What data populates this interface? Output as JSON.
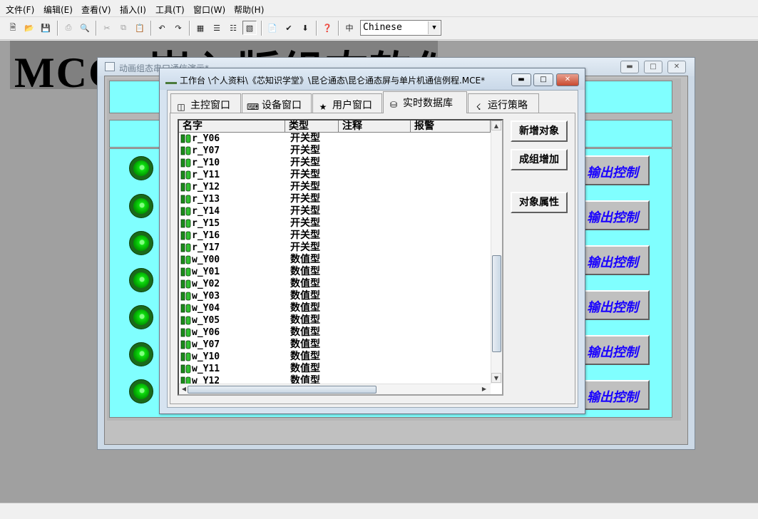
{
  "menu": [
    "文件(F)",
    "编辑(E)",
    "查看(V)",
    "插入(I)",
    "工具(T)",
    "窗口(W)",
    "帮助(H)"
  ],
  "toolbar": {
    "language": "Chinese"
  },
  "background_title": "MCGS嵌入版组态软件",
  "anim_window": {
    "title": "动画组态串口通信演示*",
    "output_button_label": "输出控制"
  },
  "workbench": {
    "title": "工作台 \\个人资料\\《芯知识学堂》\\昆仑通态\\昆仑通态屏与单片机通信例程.MCE*",
    "tabs": [
      "主控窗口",
      "设备窗口",
      "用户窗口",
      "实时数据库",
      "运行策略"
    ],
    "grid": {
      "columns": [
        "名字",
        "类型",
        "注释",
        "报警"
      ],
      "rows": [
        {
          "name": "r_Y06",
          "type": "开关型"
        },
        {
          "name": "r_Y07",
          "type": "开关型"
        },
        {
          "name": "r_Y10",
          "type": "开关型"
        },
        {
          "name": "r_Y11",
          "type": "开关型"
        },
        {
          "name": "r_Y12",
          "type": "开关型"
        },
        {
          "name": "r_Y13",
          "type": "开关型"
        },
        {
          "name": "r_Y14",
          "type": "开关型"
        },
        {
          "name": "r_Y15",
          "type": "开关型"
        },
        {
          "name": "r_Y16",
          "type": "开关型"
        },
        {
          "name": "r_Y17",
          "type": "开关型"
        },
        {
          "name": "w_Y00",
          "type": "数值型"
        },
        {
          "name": "w_Y01",
          "type": "数值型"
        },
        {
          "name": "w_Y02",
          "type": "数值型"
        },
        {
          "name": "w_Y03",
          "type": "数值型"
        },
        {
          "name": "w_Y04",
          "type": "数值型"
        },
        {
          "name": "w_Y05",
          "type": "数值型"
        },
        {
          "name": "w_Y06",
          "type": "数值型"
        },
        {
          "name": "w_Y07",
          "type": "数值型"
        },
        {
          "name": "w_Y10",
          "type": "数值型"
        },
        {
          "name": "w_Y11",
          "type": "数值型"
        },
        {
          "name": "w_Y12",
          "type": "数值型"
        }
      ]
    },
    "actions": {
      "new_object": "新增对象",
      "group_add": "成组增加",
      "object_properties": "对象属性"
    }
  }
}
